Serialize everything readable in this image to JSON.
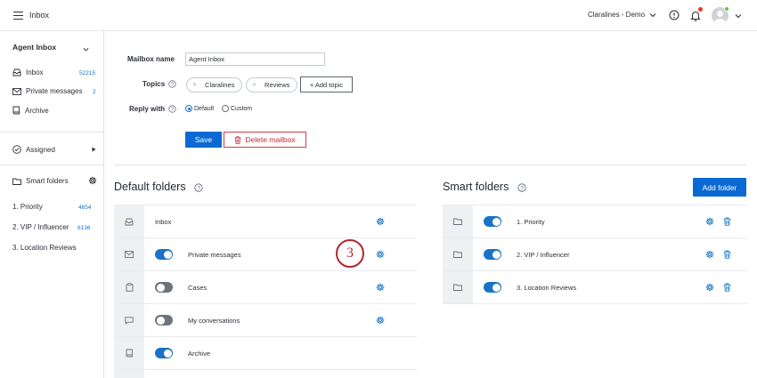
{
  "topbar": {
    "title": "Inbox",
    "brand": "Claralines - Demo"
  },
  "sidebar": {
    "heading": "Agent Inbox",
    "items": [
      {
        "label": "Inbox",
        "count": "52215"
      },
      {
        "label": "Private messages",
        "count": "2"
      },
      {
        "label": "Archive",
        "count": ""
      }
    ],
    "assigned": "Assigned",
    "smart_folders": "Smart folders",
    "smart_items": [
      {
        "label": "1. Priority",
        "count": "4654"
      },
      {
        "label": "2. VIP / Influencer",
        "count": "6136"
      },
      {
        "label": "3. Location Reviews",
        "count": ""
      }
    ]
  },
  "form": {
    "mailbox_name_label": "Mailbox name",
    "mailbox_name_value": "Agent Inbox",
    "topics_label": "Topics",
    "topics": [
      "Claralines",
      "Reviews"
    ],
    "add_topic": "+ Add topic",
    "reply_with_label": "Reply with",
    "reply_options": [
      "Default",
      "Custom"
    ],
    "reply_selected": "Default",
    "save": "Save",
    "delete": "Delete mailbox"
  },
  "default_folders": {
    "title": "Default folders",
    "rows": [
      {
        "name": "Inbox",
        "icon": "inbox-icon",
        "toggle": null
      },
      {
        "name": "Private messages",
        "icon": "envelope-icon",
        "toggle": true
      },
      {
        "name": "Cases",
        "icon": "clipboard-icon",
        "toggle": false
      },
      {
        "name": "My conversations",
        "icon": "chat-icon",
        "toggle": false
      },
      {
        "name": "Archive",
        "icon": "book-icon",
        "toggle": true
      }
    ]
  },
  "smart_folders": {
    "title": "Smart folders",
    "add_button": "Add folder",
    "rows": [
      {
        "name": "1. Priority",
        "toggle": true
      },
      {
        "name": "2. VIP / Influencer",
        "toggle": true
      },
      {
        "name": "3. Location Reviews",
        "toggle": true
      }
    ]
  },
  "step_marker": "3",
  "colors": {
    "accent": "#0b69d4",
    "danger": "#c7293a",
    "marker": "#b3262d"
  }
}
